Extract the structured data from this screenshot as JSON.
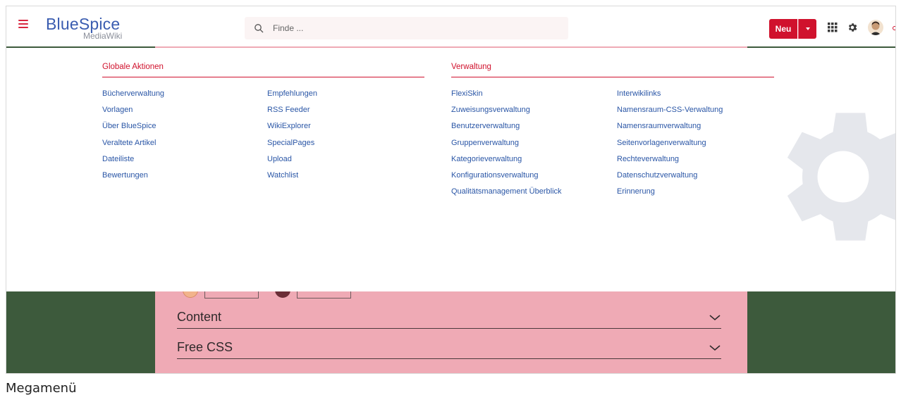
{
  "app": {
    "logo_main": "BlueSpice",
    "logo_sub": "MediaWiki"
  },
  "header": {
    "search_placeholder": "Finde ...",
    "new_button_label": "Neu",
    "brand_color": "#d0122d",
    "link_color": "#2a56a6"
  },
  "megamenu": {
    "sections": [
      {
        "title": "Globale Aktionen",
        "columns": [
          [
            "Bücherverwaltung",
            "Vorlagen",
            "Über BlueSpice",
            "Veraltete Artikel",
            "Dateiliste",
            "Bewertungen"
          ],
          [
            "Empfehlungen",
            "RSS Feeder",
            "WikiExplorer",
            "SpecialPages",
            "Upload",
            "Watchlist"
          ]
        ]
      },
      {
        "title": "Verwaltung",
        "columns": [
          [
            "FlexiSkin",
            "Zuweisungsverwaltung",
            "Benutzerverwaltung",
            "Gruppenverwaltung",
            "Kategorieverwaltung",
            "Konfigurationsverwaltung",
            "Qualitätsmanagement Überblick"
          ],
          [
            "Interwikilinks",
            "Namensraum-CSS-Verwaltung",
            "Namensraumverwaltung",
            "Seitenvorlagenverwaltung",
            "Rechteverwaltung",
            "Datenschutzverwaltung",
            "Erinnerung"
          ]
        ]
      }
    ]
  },
  "page": {
    "accordion": [
      "Content",
      "Free CSS"
    ],
    "background_color": "#3d5a3c",
    "panel_color": "#efaab5"
  },
  "caption": "Megamenü"
}
